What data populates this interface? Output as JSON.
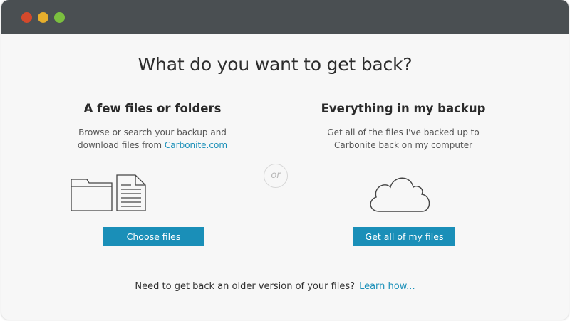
{
  "window": {
    "traffic_lights": [
      {
        "name": "close",
        "color": "#d4492b"
      },
      {
        "name": "minimize",
        "color": "#e6ae2c"
      },
      {
        "name": "zoom",
        "color": "#7bbf3f"
      }
    ]
  },
  "main": {
    "headline": "What do you want to get back?",
    "or_label": "or"
  },
  "left": {
    "title": "A few files or folders",
    "desc_line1": "Browse or search your backup and",
    "desc_line2_prefix": "download files from ",
    "desc_link": "Carbonite.com",
    "icons": [
      "folder-icon",
      "document-icon"
    ],
    "button": "Choose files"
  },
  "right": {
    "title": "Everything in my backup",
    "desc_line1": "Get all of the files I've backed up to",
    "desc_line2": "Carbonite back on my computer",
    "icons": [
      "cloud-icon"
    ],
    "button": "Get all of my files"
  },
  "footer": {
    "text": "Need to get back an older version of your files?",
    "link": "Learn how..."
  },
  "colors": {
    "accent": "#1a8fb8",
    "titlebar": "#4a4f52",
    "background": "#f7f7f7"
  }
}
